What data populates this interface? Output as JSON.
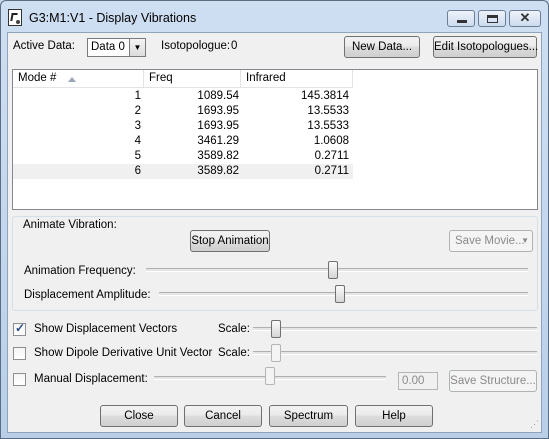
{
  "window": {
    "title": "G3:M1:V1 - Display Vibrations",
    "minimize_icon": "minimize-icon",
    "maximize_icon": "maximize-icon",
    "close_glyph": "✕"
  },
  "top": {
    "active_data_label": "Active Data:",
    "active_data_value": "Data 0",
    "isotopologue_label": "Isotopologue:",
    "isotopologue_value": "0",
    "new_data_button": "New Data...",
    "edit_isotopologues_button": "Edit Isotopologues..."
  },
  "table": {
    "columns": [
      "Mode #",
      "Freq",
      "Infrared"
    ],
    "rows": [
      {
        "mode": "1",
        "freq": "1089.54",
        "infrared": "145.3814"
      },
      {
        "mode": "2",
        "freq": "1693.95",
        "infrared": "13.5533"
      },
      {
        "mode": "3",
        "freq": "1693.95",
        "infrared": "13.5533"
      },
      {
        "mode": "4",
        "freq": "3461.29",
        "infrared": "1.0608"
      },
      {
        "mode": "5",
        "freq": "3589.82",
        "infrared": "0.2711"
      },
      {
        "mode": "6",
        "freq": "3589.82",
        "infrared": "0.2711"
      }
    ],
    "selected_row": 6
  },
  "animate": {
    "group_label": "Animate Vibration:",
    "stop_button": "Stop Animation",
    "save_movie_button": "Save Movie...",
    "frequency_label": "Animation Frequency:",
    "frequency_level": 0.49,
    "amplitude_label": "Displacement Amplitude:",
    "amplitude_level": 0.49
  },
  "options": {
    "show_vectors_label": "Show Displacement Vectors",
    "show_vectors_checked": true,
    "show_vectors_scale_label": "Scale:",
    "show_vectors_scale_level": 0.08,
    "show_dipole_label": "Show Dipole Derivative Unit Vector",
    "show_dipole_checked": false,
    "show_dipole_scale_label": "Scale:",
    "show_dipole_scale_level": 0.08,
    "manual_label": "Manual Displacement:",
    "manual_checked": false,
    "manual_value": "0.00",
    "manual_level": 0.5,
    "save_structure_button": "Save Structure..."
  },
  "buttons": {
    "close": "Close",
    "cancel": "Cancel",
    "spectrum": "Spectrum",
    "help": "Help"
  },
  "colors": {
    "titlebar": "#c8d9ee",
    "selected_row": "#f0f0f0"
  }
}
